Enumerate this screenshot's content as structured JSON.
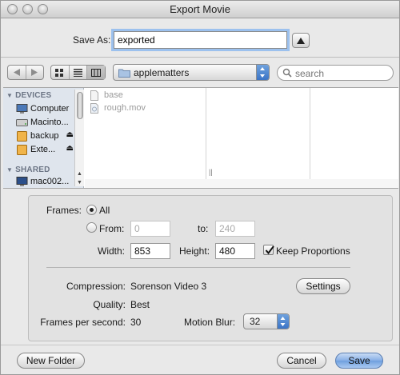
{
  "window": {
    "title": "Export Movie"
  },
  "save_as": {
    "label": "Save As:",
    "value": "exported"
  },
  "location": {
    "folder": "applematters"
  },
  "search": {
    "placeholder": "search"
  },
  "sidebar": {
    "devices_header": "DEVICES",
    "shared_header": "SHARED",
    "devices": [
      {
        "label": "Computer",
        "icon": "computer-icon",
        "eject": false
      },
      {
        "label": "Macinto...",
        "icon": "hard-drive-icon",
        "eject": false
      },
      {
        "label": "backup",
        "icon": "external-drive-icon",
        "eject": true
      },
      {
        "label": "Exte...",
        "icon": "external-drive-icon",
        "eject": true
      }
    ],
    "shared": [
      {
        "label": "mac002...",
        "icon": "network-computer-icon"
      }
    ]
  },
  "files": [
    {
      "name": "base",
      "icon": "document-icon"
    },
    {
      "name": "rough.mov",
      "icon": "movie-file-icon"
    }
  ],
  "options": {
    "frames_label": "Frames:",
    "all_label": "All",
    "from_label": "From:",
    "from_value": "0",
    "to_label": "to:",
    "to_value": "240",
    "width_label": "Width:",
    "width_value": "853",
    "height_label": "Height:",
    "height_value": "480",
    "keep_proportions_label": "Keep Proportions",
    "keep_proportions_checked": true,
    "compression_label": "Compression:",
    "compression_value": "Sorenson Video 3",
    "settings_button": "Settings",
    "quality_label": "Quality:",
    "quality_value": "Best",
    "fps_label": "Frames per second:",
    "fps_value": "30",
    "motion_blur_label": "Motion Blur:",
    "motion_blur_value": "32"
  },
  "buttons": {
    "new_folder": "New Folder",
    "cancel": "Cancel",
    "save": "Save"
  }
}
